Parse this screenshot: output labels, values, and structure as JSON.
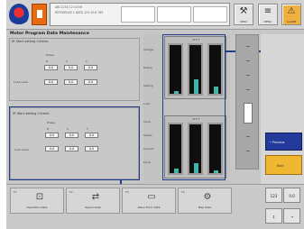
{
  "header": {
    "message_lines": [
      "ABC1234 12:34:56",
      "REFERENCE  L  DATA   123  45.6  789",
      "",
      ""
    ],
    "buttons": [
      {
        "label": "SERV",
        "icon": "wrench-icon"
      },
      {
        "label": "MENU",
        "icon": "menu-icon"
      },
      {
        "label": "ALARM",
        "icon": "alarm-icon"
      }
    ]
  },
  "page": {
    "title": "Motor  Program  Data  Maintenance"
  },
  "panel_top": {
    "header": "IR Start setting  Criteria",
    "group_label": "Phase",
    "columns": [
      "R",
      "S",
      "T"
    ],
    "row1_label": "",
    "row1_values": [
      "0.0",
      "0.0",
      "0.0"
    ],
    "row2_label": "Load  Level",
    "row2_values": [
      "0.0",
      "0.0",
      "0.0"
    ]
  },
  "panel_bottom": {
    "header": "IR Start setting  Criteria",
    "group_label": "Phase",
    "columns": [
      "R",
      "S",
      "T"
    ],
    "row1_label": "",
    "row1_values": [
      "0.0",
      "0.0",
      "0.0"
    ],
    "row2_label": "Load  Level",
    "row2_values": [
      "0.0",
      "0.0",
      "0.0"
    ]
  },
  "meters": {
    "labels": [
      "Voltage",
      "Rating",
      "Setting",
      "Load",
      "Input",
      "Speed",
      "Current",
      "Force"
    ],
    "group_top": {
      "title": "R    S    T",
      "levels": [
        0.05,
        0.3,
        0.15
      ]
    },
    "group_bottom": {
      "title": "R    S    T",
      "levels": [
        0.1,
        0.2,
        0.05
      ]
    }
  },
  "right_buttons": {
    "blue_label": "• Previous",
    "orange_label": "Back"
  },
  "function_keys": [
    {
      "num": "F1",
      "label": "Operation  Data",
      "icon": "lock-icon"
    },
    {
      "num": "F2",
      "label": "Speed  Data",
      "icon": "swap-icon"
    },
    {
      "num": "F3",
      "label": "Wave  Form  Data",
      "icon": "monitor-icon"
    },
    {
      "num": "F4",
      "label": "Map  Data",
      "icon": "settings-icon"
    }
  ],
  "side_keys": [
    "123",
    "0.0",
    "↕",
    "→"
  ],
  "colors": {
    "callout": "#1f3d8a",
    "meter_fill": "#3fb6a8",
    "accent_blue": "#233a9a",
    "accent_orange": "#f0b830"
  }
}
